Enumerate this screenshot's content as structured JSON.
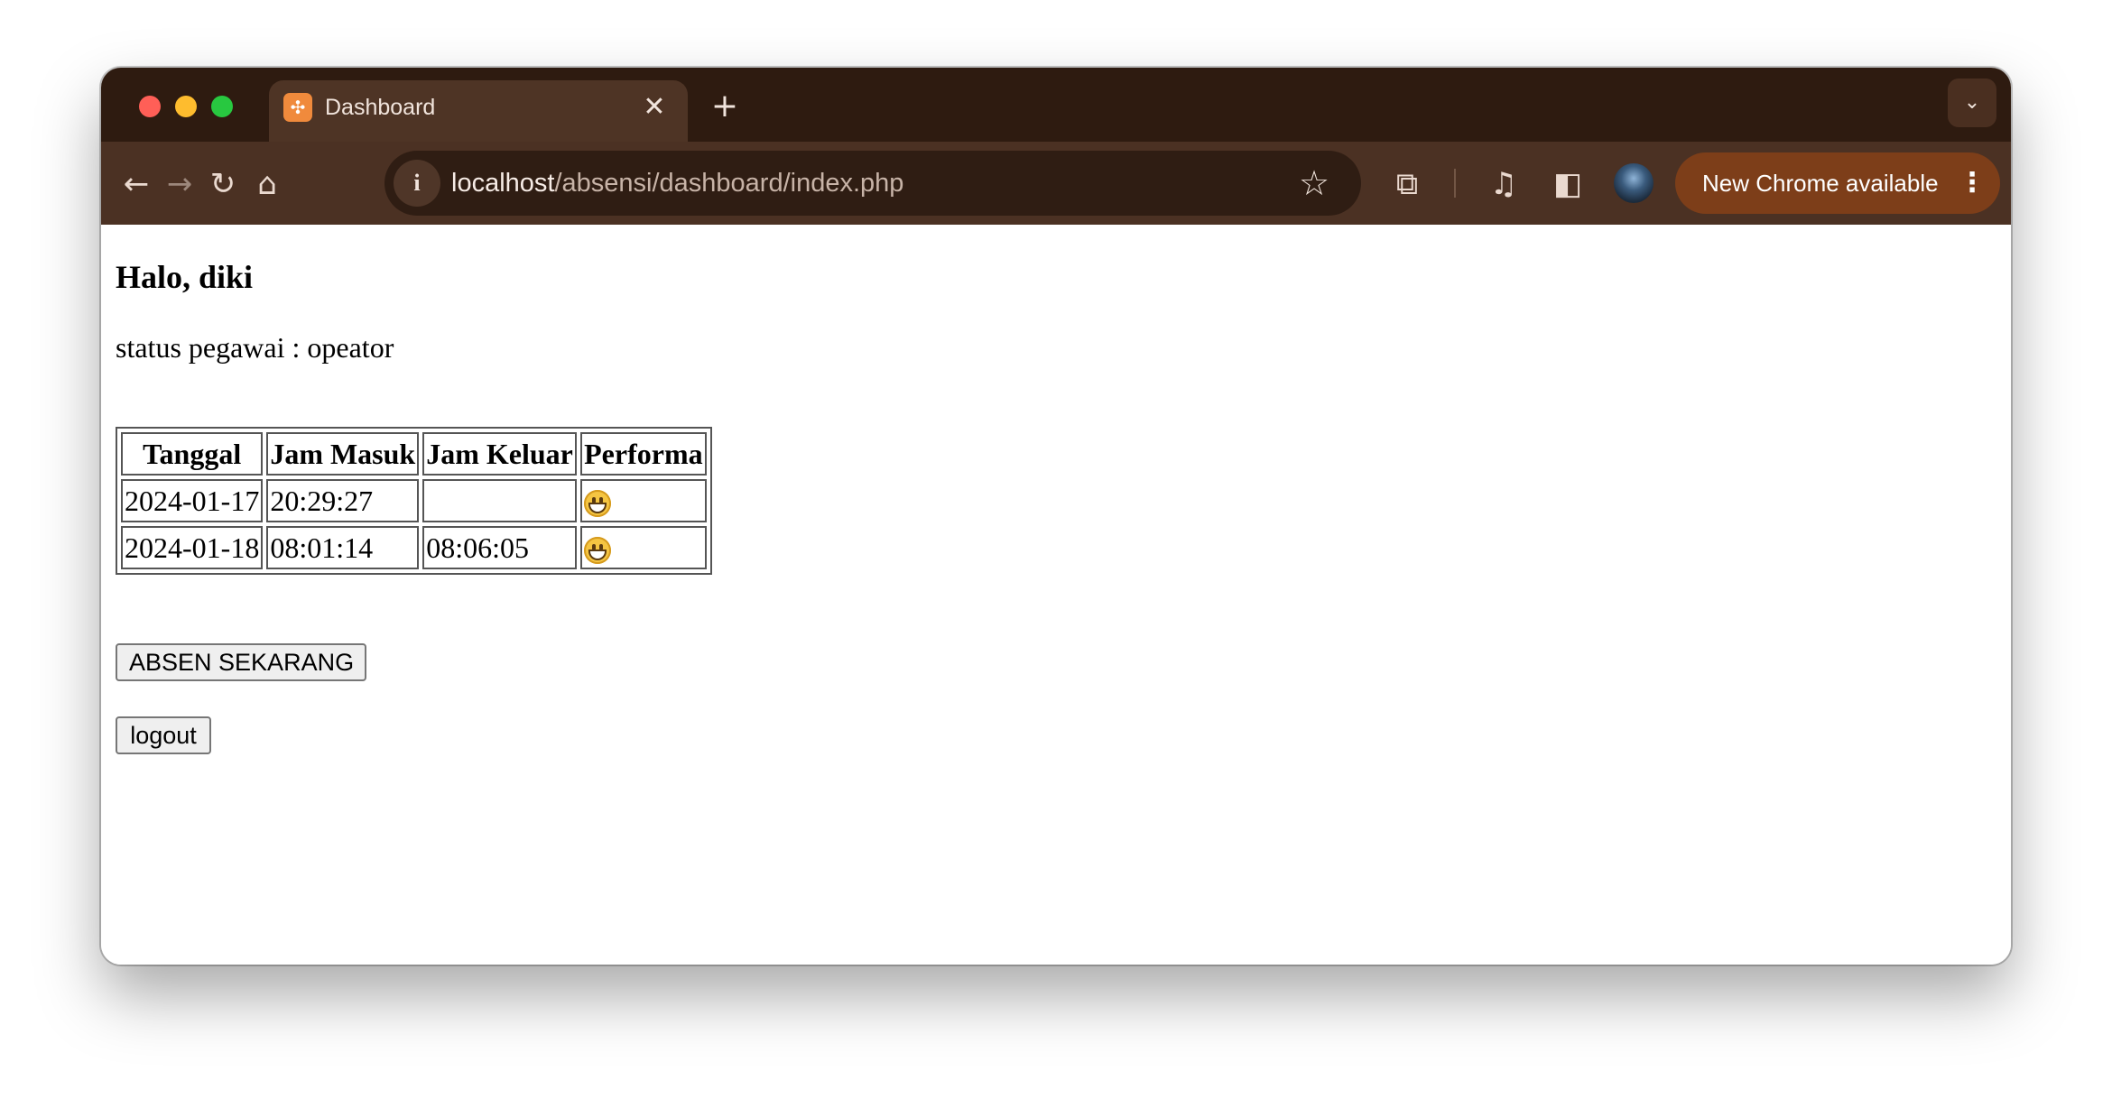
{
  "browser": {
    "tab": {
      "title": "Dashboard",
      "favicon_icon": "xampp-icon",
      "close_symbol": "✕"
    },
    "new_tab_symbol": "+",
    "tab_search_icon": "chevron-down-icon",
    "url": {
      "host": "localhost",
      "path": "/absensi/dashboard/index.php"
    },
    "update_label": "New Chrome available",
    "colors": {
      "titlebar": "#2e1b10",
      "toolbar": "#4b3123",
      "update_pill": "#7d3e19"
    }
  },
  "page": {
    "greeting": "Halo, diki",
    "status": "status pegawai : opeator",
    "table": {
      "headers": [
        "Tanggal",
        "Jam Masuk",
        "Jam Keluar",
        "Performa"
      ],
      "rows": [
        {
          "tanggal": "2024-01-17",
          "jam_masuk": "20:29:27",
          "jam_keluar": "",
          "performa_icon": "grinning-face-icon"
        },
        {
          "tanggal": "2024-01-18",
          "jam_masuk": "08:01:14",
          "jam_keluar": "08:06:05",
          "performa_icon": "grinning-face-icon"
        }
      ]
    },
    "absen_button": "ABSEN SEKARANG",
    "logout_button": "logout"
  }
}
